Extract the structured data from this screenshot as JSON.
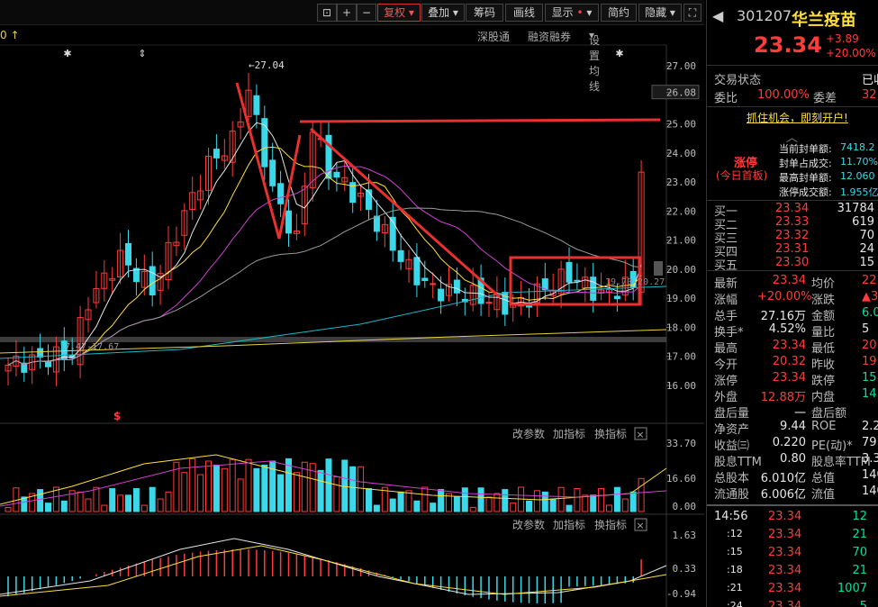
{
  "toolbar": {
    "buttons": [
      "复权",
      "叠加",
      "筹码",
      "画线",
      "显示",
      "简约",
      "隐藏"
    ],
    "expand_icon": "expand-icon",
    "lock_icon": "lock-icon"
  },
  "chart_header": {
    "left_marker": "0 ↑",
    "links": [
      "深股通",
      "融资融券",
      "设置均线"
    ]
  },
  "price_axis": {
    "ticks": [
      "27.00",
      "26.08",
      "25.00",
      "24.00",
      "23.00",
      "22.00",
      "21.00",
      "20.00",
      "19.00",
      "18.00",
      "17.00",
      "16.00"
    ],
    "high_label": "27.04",
    "low_label": "17.47-17.67",
    "box_label": "19.70-20.27"
  },
  "volume_panel": {
    "buttons": [
      "改参数",
      "加指标",
      "换指标"
    ],
    "ticks": [
      "33.70",
      "16.60",
      "0.00"
    ],
    "marker": "$"
  },
  "macd_panel": {
    "buttons": [
      "改参数",
      "加指标",
      "换指标"
    ],
    "ticks": [
      "1.63",
      "0.33",
      "-0.94"
    ]
  },
  "stock": {
    "code": "301207",
    "name": "华兰疫苗",
    "price": "23.34",
    "change": "+3.89",
    "change_pct": "+20.00%",
    "status_label": "交易状态",
    "status_value": "已收",
    "weibi_label": "委比",
    "weibi_value": "100.00%",
    "weicha_label": "委差",
    "weicha_value": "32",
    "ad": "抓住机会，即刻开户!",
    "limit_title": "涨停",
    "limit_sub": "(今日首板)",
    "limit_rows": [
      {
        "label": "当前封单额:",
        "value": "7418.2"
      },
      {
        "label": "封单占成交:",
        "value": "11.70%"
      },
      {
        "label": "最高封单额:",
        "value": "12.060"
      },
      {
        "label": "涨停成交额:",
        "value": "1.955亿"
      }
    ],
    "bids": [
      {
        "label": "买一",
        "price": "23.34",
        "vol": "31784"
      },
      {
        "label": "买二",
        "price": "23.33",
        "vol": "619"
      },
      {
        "label": "买三",
        "price": "23.32",
        "vol": "70"
      },
      {
        "label": "买四",
        "price": "23.31",
        "vol": "24"
      },
      {
        "label": "买五",
        "price": "23.30",
        "vol": "15"
      }
    ],
    "stats": [
      {
        "l1": "最新",
        "v1": "23.34",
        "l2": "均价",
        "v2": "22"
      },
      {
        "l1": "涨幅",
        "v1": "+20.00%",
        "l2": "涨跌",
        "v2": "▲3"
      },
      {
        "l1": "总手",
        "v1": "27.16万",
        "l2": "金额",
        "v2": "6.0"
      },
      {
        "l1": "换手*",
        "v1": "4.52%",
        "l2": "量比",
        "v2": "5"
      },
      {
        "l1": "最高",
        "v1": "23.34",
        "l2": "最低",
        "v2": "20"
      },
      {
        "l1": "今开",
        "v1": "20.32",
        "l2": "昨收",
        "v2": "19"
      },
      {
        "l1": "涨停",
        "v1": "23.34",
        "l2": "跌停",
        "v2": "15"
      },
      {
        "l1": "外盘",
        "v1": "12.88万",
        "l2": "内盘",
        "v2": "14.2"
      },
      {
        "l1": "盘后量",
        "v1": "一",
        "l2": "盘后额",
        "v2": ""
      },
      {
        "l1": "净资产",
        "v1": "9.44",
        "l2": "ROE",
        "v2": "2.2"
      },
      {
        "l1": "收益㈢",
        "v1": "0.220",
        "l2": "PE(动)*",
        "v2": "79"
      },
      {
        "l1": "股息TTM",
        "v1": "0.80",
        "l2": "股息率TTM",
        "v2": "3.3"
      },
      {
        "l1": "总股本",
        "v1": "6.010亿",
        "l2": "总值",
        "v2": "140."
      },
      {
        "l1": "流通股",
        "v1": "6.006亿",
        "l2": "流值",
        "v2": "140."
      }
    ],
    "ticks": [
      {
        "time": "14:56",
        "price": "23.34",
        "vol": "12"
      },
      {
        "time": ":12",
        "price": "23.34",
        "vol": "21"
      },
      {
        "time": ":15",
        "price": "23.34",
        "vol": "70"
      },
      {
        "time": ":18",
        "price": "23.34",
        "vol": "21"
      },
      {
        "time": ":21",
        "price": "23.34",
        "vol": "1007"
      },
      {
        "time": ":24",
        "price": "23.34",
        "vol": "5"
      }
    ]
  },
  "colors": {
    "up": "#ff3b3b",
    "down": "#3ad8e8",
    "ma5": "#e6e6e6",
    "ma10": "#ffdf3a",
    "ma20": "#d040d0",
    "ma60": "#9a9a9a",
    "annot": "#e83030"
  }
}
